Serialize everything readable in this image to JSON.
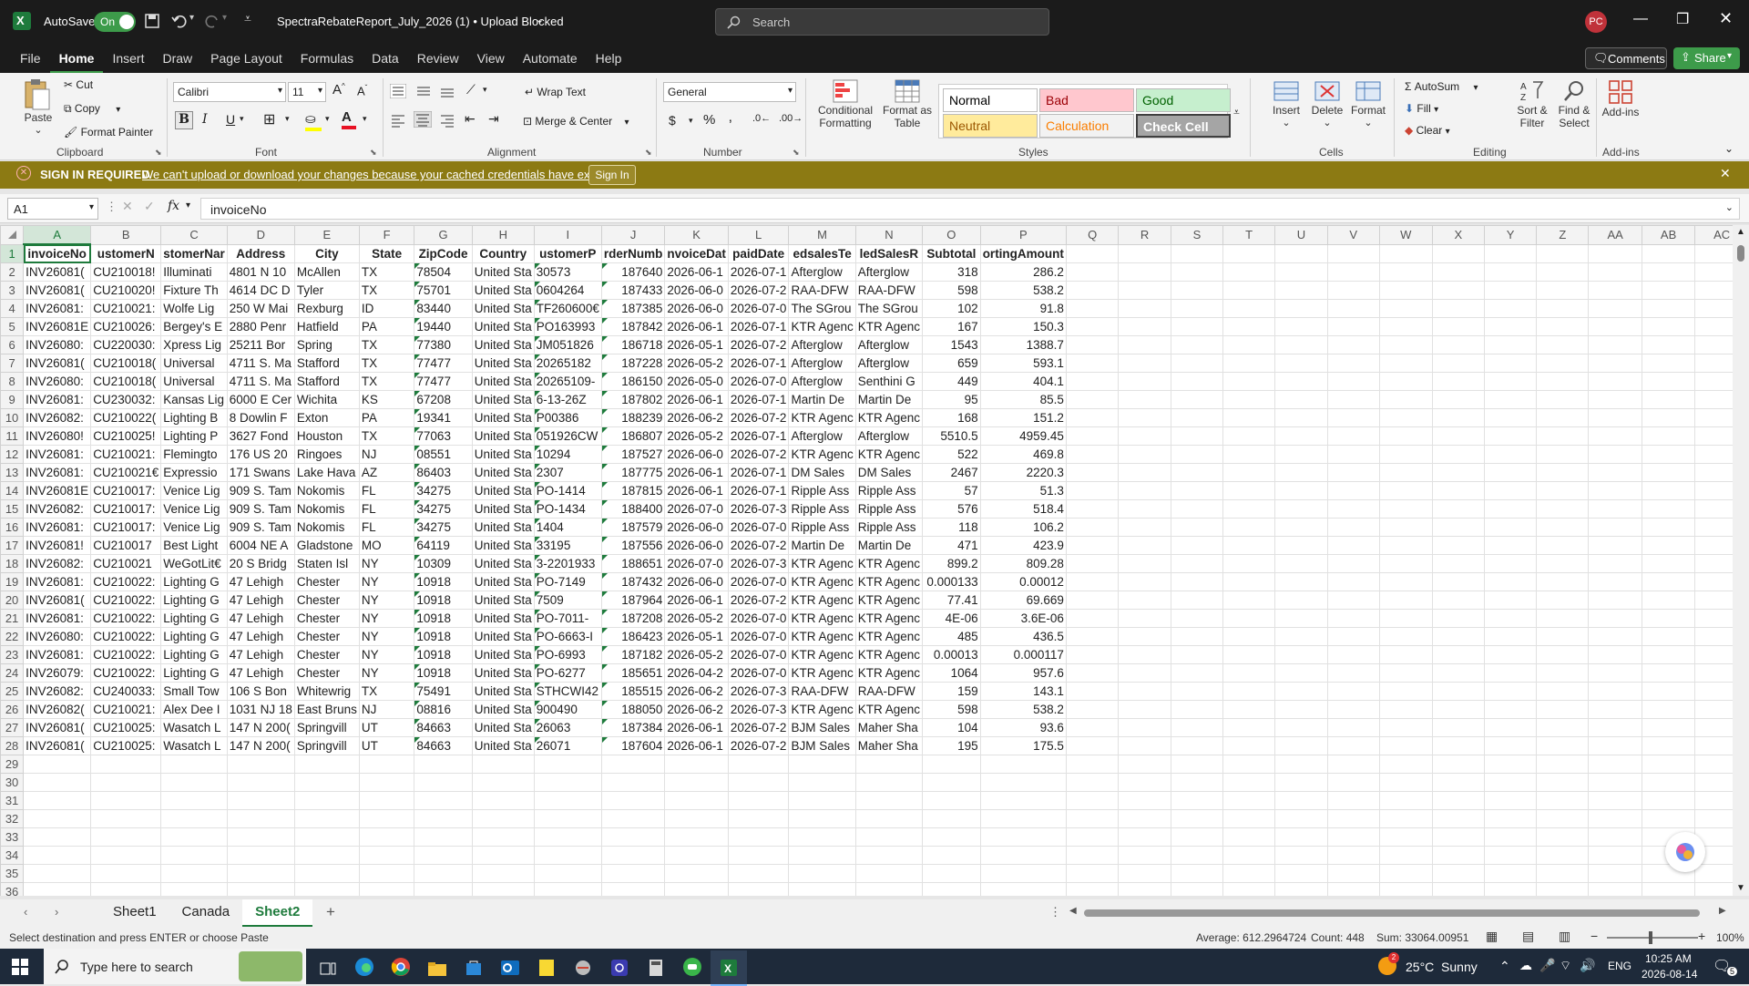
{
  "titlebar": {
    "autosave_label": "AutoSave",
    "autosave_state": "On",
    "filename": "SpectraRebateReport_July_2026 (1) • Upload Blocked",
    "search_placeholder": "Search",
    "user_initials": "PC"
  },
  "menu": {
    "tabs": [
      "File",
      "Home",
      "Insert",
      "Draw",
      "Page Layout",
      "Formulas",
      "Data",
      "Review",
      "View",
      "Automate",
      "Help"
    ],
    "active_tab": "Home",
    "comments_label": "Comments",
    "share_label": "Share"
  },
  "ribbon": {
    "clipboard": {
      "paste": "Paste",
      "cut": "Cut",
      "copy": "Copy",
      "format_painter": "Format Painter",
      "group": "Clipboard"
    },
    "font": {
      "name": "Calibri",
      "size": "11",
      "group": "Font"
    },
    "alignment": {
      "wrap_text": "Wrap Text",
      "merge_center": "Merge & Center",
      "group": "Alignment"
    },
    "number": {
      "format": "General",
      "group": "Number"
    },
    "styles": {
      "conditional": "Conditional Formatting",
      "format_table": "Format as Table",
      "cells": [
        {
          "label": "Normal",
          "bg": "#ffffff",
          "fg": "#000000"
        },
        {
          "label": "Bad",
          "bg": "#ffc7ce",
          "fg": "#9c0006"
        },
        {
          "label": "Good",
          "bg": "#c6efce",
          "fg": "#006100"
        },
        {
          "label": "Neutral",
          "bg": "#ffeb9c",
          "fg": "#9c5700"
        },
        {
          "label": "Calculation",
          "bg": "#f2f2f2",
          "fg": "#fa7d00"
        },
        {
          "label": "Check Cell",
          "bg": "#a5a5a5",
          "fg": "#ffffff"
        }
      ],
      "group": "Styles"
    },
    "cells": {
      "insert": "Insert",
      "delete": "Delete",
      "format": "Format",
      "group": "Cells"
    },
    "editing": {
      "autosum": "AutoSum",
      "fill": "Fill",
      "clear": "Clear",
      "sort_filter": "Sort & Filter",
      "find_select": "Find & Select",
      "group": "Editing"
    },
    "addins": {
      "label": "Add-ins",
      "group": "Add-ins"
    }
  },
  "message": {
    "title": "SIGN IN REQUIRED",
    "text": "We can't upload or download your changes because your cached credentials have expired.",
    "button": "Sign In"
  },
  "formula_bar": {
    "name_box": "A1",
    "content": "invoiceNo"
  },
  "grid": {
    "columns": [
      "A",
      "B",
      "C",
      "D",
      "E",
      "F",
      "G",
      "H",
      "I",
      "J",
      "K",
      "L",
      "M",
      "N",
      "O",
      "P",
      "Q",
      "R",
      "S",
      "T",
      "U",
      "V",
      "W",
      "X",
      "Y",
      "Z",
      "AA",
      "AB",
      "AC"
    ],
    "headers": [
      "invoiceNo",
      "ustomerN",
      "stomerNar",
      "Address",
      "City",
      "State",
      "ZipCode",
      "Country",
      "ustomerP",
      "rderNumb",
      "nvoiceDat",
      "paidDate",
      "edsalesTe",
      "ledSalesR",
      "Subtotal",
      "ortingAmount"
    ],
    "rows": [
      [
        "INV26081(",
        "CU210018!",
        "Illuminati",
        "4801 N 10",
        "McAllen",
        "TX",
        "78504",
        "United Sta",
        "30573",
        "187640",
        "2026-06-1",
        "2026-07-1",
        "Afterglow",
        "Afterglow",
        "318",
        "286.2"
      ],
      [
        "INV26081(",
        "CU210020!",
        "Fixture Th",
        "4614 DC D",
        "Tyler",
        "TX",
        "75701",
        "United Sta",
        "0604264",
        "187433",
        "2026-06-0",
        "2026-07-2",
        "RAA-DFW",
        "RAA-DFW",
        "598",
        "538.2"
      ],
      [
        "INV26081:",
        "CU210021:",
        "Wolfe Lig",
        "250 W Mai",
        "Rexburg",
        "ID",
        "83440",
        "United Sta",
        "TF260600€",
        "187385",
        "2026-06-0",
        "2026-07-0",
        "The SGrou",
        "The SGrou",
        "102",
        "91.8"
      ],
      [
        "INV26081E",
        "CU210026:",
        "Bergey's E",
        "2880 Penr",
        "Hatfield",
        "PA",
        "19440",
        "United Sta",
        "PO163993",
        "187842",
        "2026-06-1",
        "2026-07-1",
        "KTR Agenc",
        "KTR Agenc",
        "167",
        "150.3"
      ],
      [
        "INV26080:",
        "CU220030:",
        "Xpress Lig",
        "25211 Bor",
        "Spring",
        "TX",
        "77380",
        "United Sta",
        "JM051826",
        "186718",
        "2026-05-1",
        "2026-07-2",
        "Afterglow",
        "Afterglow",
        "1543",
        "1388.7"
      ],
      [
        "INV26081(",
        "CU210018(",
        "Universal",
        "4711 S. Ma",
        "Stafford",
        "TX",
        "77477",
        "United Sta",
        "20265182",
        "187228",
        "2026-05-2",
        "2026-07-1",
        "Afterglow",
        "Afterglow",
        "659",
        "593.1"
      ],
      [
        "INV26080:",
        "CU210018(",
        "Universal",
        "4711 S. Ma",
        "Stafford",
        "TX",
        "77477",
        "United Sta",
        "20265109-",
        "186150",
        "2026-05-0",
        "2026-07-0",
        "Afterglow",
        "Senthini G",
        "449",
        "404.1"
      ],
      [
        "INV26081:",
        "CU230032:",
        "Kansas Lig",
        "6000 E Cer",
        "Wichita",
        "KS",
        "67208",
        "United Sta",
        "6-13-26Z",
        "187802",
        "2026-06-1",
        "2026-07-1",
        "Martin De",
        "Martin De",
        "95",
        "85.5"
      ],
      [
        "INV26082:",
        "CU210022(",
        "Lighting B",
        "8 Dowlin F",
        "Exton",
        "PA",
        "19341",
        "United Sta",
        "P00386",
        "188239",
        "2026-06-2",
        "2026-07-2",
        "KTR Agenc",
        "KTR Agenc",
        "168",
        "151.2"
      ],
      [
        "INV26080!",
        "CU210025!",
        "Lighting P",
        "3627 Fond",
        "Houston",
        "TX",
        "77063",
        "United Sta",
        "051926CW",
        "186807",
        "2026-05-2",
        "2026-07-1",
        "Afterglow",
        "Afterglow",
        "5510.5",
        "4959.45"
      ],
      [
        "INV26081:",
        "CU210021:",
        "Flemingto",
        "176 US 20",
        "Ringoes",
        "NJ",
        "08551",
        "United Sta",
        "10294",
        "187527",
        "2026-06-0",
        "2026-07-2",
        "KTR Agenc",
        "KTR Agenc",
        "522",
        "469.8"
      ],
      [
        "INV26081:",
        "CU210021€",
        "Expressio",
        "171 Swans",
        "Lake Hava",
        "AZ",
        "86403",
        "United Sta",
        "2307",
        "187775",
        "2026-06-1",
        "2026-07-1",
        "DM Sales",
        "DM Sales",
        "2467",
        "2220.3"
      ],
      [
        "INV26081E",
        "CU210017:",
        "Venice Lig",
        "909 S. Tam",
        "Nokomis",
        "FL",
        "34275",
        "United Sta",
        "PO-1414",
        "187815",
        "2026-06-1",
        "2026-07-1",
        "Ripple Ass",
        "Ripple Ass",
        "57",
        "51.3"
      ],
      [
        "INV26082:",
        "CU210017:",
        "Venice Lig",
        "909 S. Tam",
        "Nokomis",
        "FL",
        "34275",
        "United Sta",
        "PO-1434",
        "188400",
        "2026-07-0",
        "2026-07-3",
        "Ripple Ass",
        "Ripple Ass",
        "576",
        "518.4"
      ],
      [
        "INV26081:",
        "CU210017:",
        "Venice Lig",
        "909 S. Tam",
        "Nokomis",
        "FL",
        "34275",
        "United Sta",
        "1404",
        "187579",
        "2026-06-0",
        "2026-07-0",
        "Ripple Ass",
        "Ripple Ass",
        "118",
        "106.2"
      ],
      [
        "INV26081!",
        "CU210017",
        "Best Light",
        "6004 NE A",
        "Gladstone",
        "MO",
        "64119",
        "United Sta",
        "33195",
        "187556",
        "2026-06-0",
        "2026-07-2",
        "Martin De",
        "Martin De",
        "471",
        "423.9"
      ],
      [
        "INV26082:",
        "CU210021",
        "WeGotLit€",
        "20 S Bridg",
        "Staten Isl",
        "NY",
        "10309",
        "United Sta",
        "3-2201933",
        "188651",
        "2026-07-0",
        "2026-07-3",
        "KTR Agenc",
        "KTR Agenc",
        "899.2",
        "809.28"
      ],
      [
        "INV26081:",
        "CU210022:",
        "Lighting G",
        "47 Lehigh",
        "Chester",
        "NY",
        "10918",
        "United Sta",
        "PO-7149",
        "187432",
        "2026-06-0",
        "2026-07-0",
        "KTR Agenc",
        "KTR Agenc",
        "0.000133",
        "0.00012"
      ],
      [
        "INV26081(",
        "CU210022:",
        "Lighting G",
        "47 Lehigh",
        "Chester",
        "NY",
        "10918",
        "United Sta",
        "7509",
        "187964",
        "2026-06-1",
        "2026-07-2",
        "KTR Agenc",
        "KTR Agenc",
        "77.41",
        "69.669"
      ],
      [
        "INV26081:",
        "CU210022:",
        "Lighting G",
        "47 Lehigh",
        "Chester",
        "NY",
        "10918",
        "United Sta",
        "PO-7011-",
        "187208",
        "2026-05-2",
        "2026-07-0",
        "KTR Agenc",
        "KTR Agenc",
        "4E-06",
        "3.6E-06"
      ],
      [
        "INV26080:",
        "CU210022:",
        "Lighting G",
        "47 Lehigh",
        "Chester",
        "NY",
        "10918",
        "United Sta",
        "PO-6663-I",
        "186423",
        "2026-05-1",
        "2026-07-0",
        "KTR Agenc",
        "KTR Agenc",
        "485",
        "436.5"
      ],
      [
        "INV26081:",
        "CU210022:",
        "Lighting G",
        "47 Lehigh",
        "Chester",
        "NY",
        "10918",
        "United Sta",
        "PO-6993",
        "187182",
        "2026-05-2",
        "2026-07-0",
        "KTR Agenc",
        "KTR Agenc",
        "0.00013",
        "0.000117"
      ],
      [
        "INV26079:",
        "CU210022:",
        "Lighting G",
        "47 Lehigh",
        "Chester",
        "NY",
        "10918",
        "United Sta",
        "PO-6277",
        "185651",
        "2026-04-2",
        "2026-07-0",
        "KTR Agenc",
        "KTR Agenc",
        "1064",
        "957.6"
      ],
      [
        "INV26082:",
        "CU240033:",
        "Small Tow",
        "106 S Bon",
        "Whitewrig",
        "TX",
        "75491",
        "United Sta",
        "STHCWI42",
        "185515",
        "2026-06-2",
        "2026-07-3",
        "RAA-DFW",
        "RAA-DFW",
        "159",
        "143.1"
      ],
      [
        "INV26082(",
        "CU210021:",
        "Alex Dee I",
        "1031 NJ 18",
        "East Bruns",
        "NJ",
        "08816",
        "United Sta",
        "900490",
        "188050",
        "2026-06-2",
        "2026-07-3",
        "KTR Agenc",
        "KTR Agenc",
        "598",
        "538.2"
      ],
      [
        "INV26081(",
        "CU210025:",
        "Wasatch L",
        "147 N 200(",
        "Springvill",
        "UT",
        "84663",
        "United Sta",
        "26063",
        "187384",
        "2026-06-1",
        "2026-07-2",
        "BJM Sales",
        "Maher Sha",
        "104",
        "93.6"
      ],
      [
        "INV26081(",
        "CU210025:",
        "Wasatch L",
        "147 N 200(",
        "Springvill",
        "UT",
        "84663",
        "United Sta",
        "26071",
        "187604",
        "2026-06-1",
        "2026-07-2",
        "BJM Sales",
        "Maher Sha",
        "195",
        "175.5"
      ]
    ],
    "visible_rows": 36
  },
  "sheets": {
    "tabs": [
      "Sheet1",
      "Canada",
      "Sheet2"
    ],
    "active": "Sheet2"
  },
  "status": {
    "message": "Select destination and press ENTER or choose Paste",
    "average": "Average: 612.2964724",
    "count": "Count: 448",
    "sum": "Sum: 33064.00951",
    "zoom": "100%"
  },
  "taskbar": {
    "search_placeholder": "Type here to search",
    "weather": "25°C  Sunny",
    "weather_badge": "2",
    "lang": "ENG",
    "time": "10:25 AM",
    "date": "2026-08-14",
    "notif_count": "5"
  }
}
